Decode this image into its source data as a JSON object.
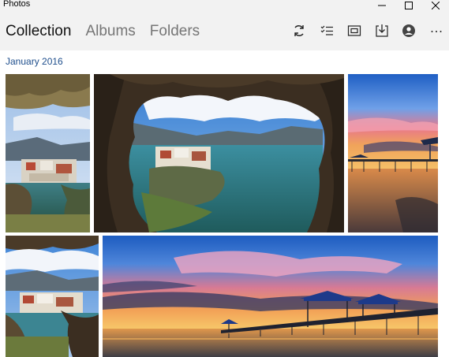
{
  "window": {
    "title": "Photos",
    "minimize_icon": "minimize-icon",
    "maximize_icon": "maximize-icon",
    "close_icon": "close-icon"
  },
  "nav": {
    "tabs": [
      {
        "label": "Collection",
        "active": true
      },
      {
        "label": "Albums",
        "active": false
      },
      {
        "label": "Folders",
        "active": false
      }
    ]
  },
  "toolbar": {
    "icons": [
      "refresh-icon",
      "select-icon",
      "slideshow-icon",
      "import-icon",
      "account-icon",
      "more-icon"
    ]
  },
  "collection": {
    "section_date": "January 2016",
    "photos": [
      {
        "name": "photo-coastal-village-1",
        "subject": "village-through-rock"
      },
      {
        "name": "photo-rock-arch-coast",
        "subject": "rock-arch"
      },
      {
        "name": "photo-pier-sunset-1",
        "subject": "pier-sunset"
      },
      {
        "name": "photo-coastal-village-2",
        "subject": "village-through-rock"
      },
      {
        "name": "photo-pier-sunset-2",
        "subject": "pier-sunset-wide"
      }
    ]
  },
  "colors": {
    "title_bar": "#f2f2f2",
    "date_link": "#1e4e8c",
    "nav_active": "#111111",
    "nav_inactive": "#767676"
  }
}
